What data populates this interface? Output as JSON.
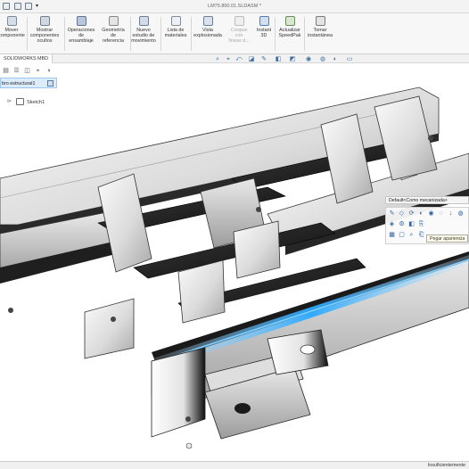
{
  "window": {
    "title": "LM75.800.01.SLDASM *"
  },
  "ribbon": {
    "buttons": [
      {
        "id": "move-component",
        "label": "Mover\ncomponente",
        "icon": "move-component-icon"
      },
      {
        "id": "show-hidden",
        "label": "Mostrar\ncomponentes\nocultos",
        "icon": "show-hidden-icon"
      },
      {
        "id": "assembly-ops",
        "label": "Operaciones\nde\nensamblaje",
        "icon": "assembly-features-icon"
      },
      {
        "id": "ref-geometry",
        "label": "Geometría\nde\nreferencia",
        "icon": "reference-geometry-icon"
      },
      {
        "id": "motion-study",
        "label": "Nuevo\nestudio de\nmovimiento",
        "icon": "motion-study-icon"
      },
      {
        "id": "bom",
        "label": "Lista de\nmateriales",
        "icon": "bill-of-materials-icon"
      },
      {
        "id": "exploded-view",
        "label": "Vista\nexplosionada",
        "icon": "exploded-view-icon"
      },
      {
        "id": "explode-sketch",
        "label": "Croquis\ncon\nlíneas d...",
        "icon": "explode-line-sketch-icon"
      },
      {
        "id": "instant3d",
        "label": "Instant\n3D",
        "icon": "instant3d-icon"
      },
      {
        "id": "speedpak",
        "label": "Actualizar\nSpeedPak",
        "icon": "speedpak-icon"
      },
      {
        "id": "snapshot",
        "label": "Tomar\ninstantánea",
        "icon": "snapshot-icon"
      }
    ]
  },
  "tabs": {
    "mbd": "SOLIDWORKS MBD"
  },
  "feature_tree": {
    "structure_label": "bro estructural1",
    "sketch_label": "Sketch1"
  },
  "context_toolbar": {
    "title": "Default<Como mecanizada>",
    "tooltip": "Pegar apariencia"
  },
  "status": {
    "text": "Insuficientemente"
  },
  "colors": {
    "accent": "#3a6ea5",
    "highlight_glow": "#2aa8ff",
    "selection_box": "#dcecfb",
    "steel_light": "#f2f2f2",
    "steel_mid": "#c8c8c8",
    "steel_dark": "#1c1c1c"
  }
}
